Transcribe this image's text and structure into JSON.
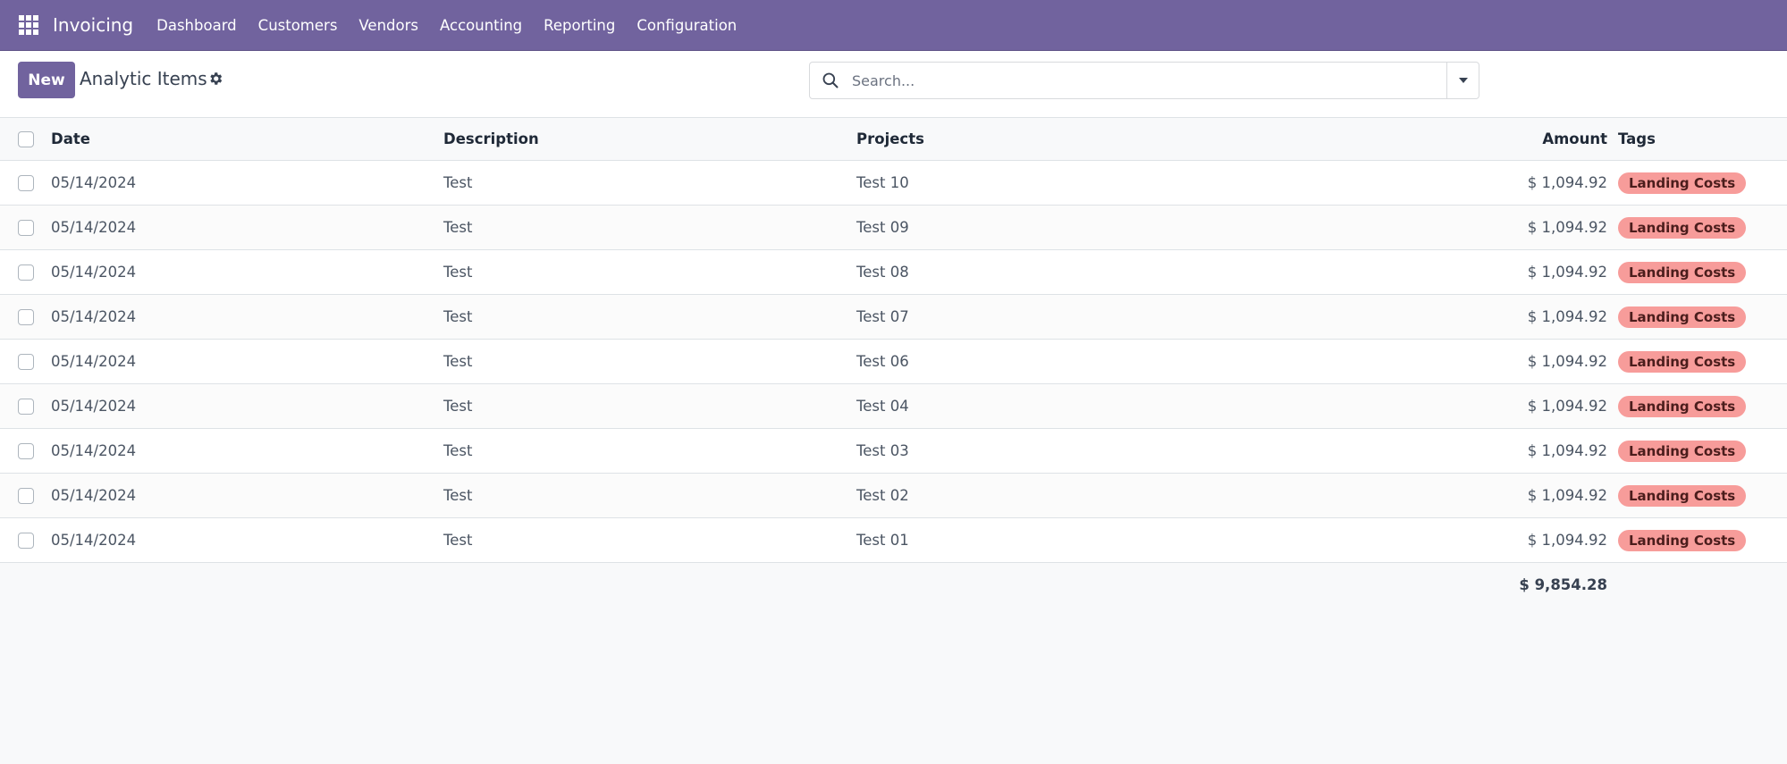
{
  "navbar": {
    "app_name": "Invoicing",
    "menu": [
      "Dashboard",
      "Customers",
      "Vendors",
      "Accounting",
      "Reporting",
      "Configuration"
    ],
    "brand_color": "#71639e"
  },
  "control_panel": {
    "new_label": "New",
    "title": "Analytic Items",
    "search_placeholder": "Search..."
  },
  "list": {
    "columns": [
      "Date",
      "Description",
      "Projects",
      "Amount",
      "Tags"
    ],
    "rows": [
      {
        "date": "05/14/2024",
        "description": "Test",
        "project": "Test 10",
        "amount": "$ 1,094.92",
        "tag": "Landing Costs"
      },
      {
        "date": "05/14/2024",
        "description": "Test",
        "project": "Test 09",
        "amount": "$ 1,094.92",
        "tag": "Landing Costs"
      },
      {
        "date": "05/14/2024",
        "description": "Test",
        "project": "Test 08",
        "amount": "$ 1,094.92",
        "tag": "Landing Costs"
      },
      {
        "date": "05/14/2024",
        "description": "Test",
        "project": "Test 07",
        "amount": "$ 1,094.92",
        "tag": "Landing Costs"
      },
      {
        "date": "05/14/2024",
        "description": "Test",
        "project": "Test 06",
        "amount": "$ 1,094.92",
        "tag": "Landing Costs"
      },
      {
        "date": "05/14/2024",
        "description": "Test",
        "project": "Test 04",
        "amount": "$ 1,094.92",
        "tag": "Landing Costs"
      },
      {
        "date": "05/14/2024",
        "description": "Test",
        "project": "Test 03",
        "amount": "$ 1,094.92",
        "tag": "Landing Costs"
      },
      {
        "date": "05/14/2024",
        "description": "Test",
        "project": "Test 02",
        "amount": "$ 1,094.92",
        "tag": "Landing Costs"
      },
      {
        "date": "05/14/2024",
        "description": "Test",
        "project": "Test 01",
        "amount": "$ 1,094.92",
        "tag": "Landing Costs"
      }
    ],
    "total_amount": "$ 9,854.28",
    "tag_color": "#f79c9a"
  }
}
